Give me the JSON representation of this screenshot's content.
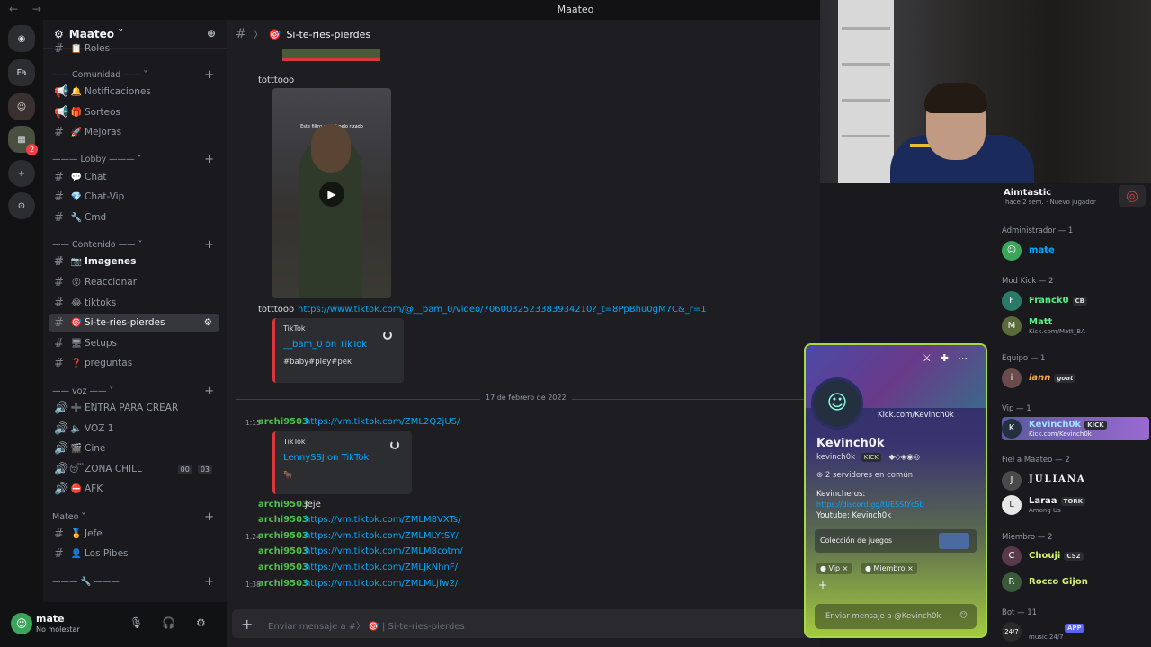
{
  "window": {
    "title": "Maateo",
    "nav": "← →"
  },
  "server": {
    "name": "Maateo ˅",
    "list": [
      "Fa"
    ]
  },
  "categories": {
    "comunidad": "—— Comunidad ——",
    "lobby": "——— Lobby ———",
    "contenido": "—— Contenido ——",
    "voz": "—— voz ——",
    "maateo": "Mateo"
  },
  "channels": {
    "roles": "Roles",
    "notificaciones": "Notificaciones",
    "sorteos": "Sorteos",
    "mejoras": "Mejoras",
    "chat": "Chat",
    "chatvip": "Chat-Vip",
    "cmd": "Cmd",
    "imagenes": "Imagenes",
    "reaccionar": "Reaccionar",
    "tiktoks": "tiktoks",
    "sirie": "Si-te-ries-pierdes",
    "setups": "Setups",
    "preguntas": "preguntas",
    "entra": "ENTRA PARA CREAR",
    "voz1": "VOZ 1",
    "cine": "Cine",
    "zona": "ZONA CHILL",
    "zona_counts": [
      "00",
      "03"
    ],
    "afk": "AFK",
    "jefe": "Jefe",
    "pibes": "Los Pibes"
  },
  "user": {
    "name": "mate",
    "status": "No molestar"
  },
  "chat": {
    "header": "Si-te-ries-pierdes",
    "msg1_text": "totttooo",
    "video_caption": "Este filtro con el pelo rizado",
    "msg2_text": "totttooo",
    "msg2_link": "https://www.tiktok.com/@__bam_0/video/7060032523383934210?_t=8PpBhu0gM7C&_r=1",
    "embed1": {
      "provider": "TikTok",
      "title": "__bam_0 on TikTok",
      "desc": "#baby#pley#pек"
    },
    "date_divider": "17 de febrero de 2022",
    "msg3": {
      "time": "1:15",
      "author": "archi9503",
      "link": "https://vm.tiktok.com/ZML2Q2jUS/"
    },
    "embed2": {
      "provider": "TikTok",
      "title": "LennySSJ on TikTok"
    },
    "msg4": {
      "author": "archi9503",
      "text": "jeje"
    },
    "msg5": {
      "author": "archi9503",
      "link": "https://vm.tiktok.com/ZMLM8VXTs/"
    },
    "msg6": {
      "time": "1:24",
      "author": "archi9503",
      "link": "https://vm.tiktok.com/ZMLMLYtSY/"
    },
    "msg7": {
      "author": "archi9503",
      "link": "https://vm.tiktok.com/ZMLM8cotm/"
    },
    "msg8": {
      "author": "archi9503",
      "link": "https://vm.tiktok.com/ZMLJkNhnF/"
    },
    "msg9": {
      "time": "1:38",
      "author": "archi9503",
      "link": "https://vm.tiktok.com/ZMLMLjfw2/"
    },
    "input_placeholder": "Enviar mensaje a #〉 🎯 | Si-te-ries-pierdes"
  },
  "members": {
    "top": {
      "name": "Aimtastic",
      "sub": "hace 2 sem. · Nuevo jugador"
    },
    "admin_cat": "Administrador — 1",
    "admin": {
      "name": "mate"
    },
    "modkick_cat": "Mod Kick — 2",
    "franck": {
      "name": "Franck0",
      "tag": "CB"
    },
    "matt": {
      "name": "Matt",
      "sub": "Kick.com/Matt_BA"
    },
    "equipo_cat": "Equipo — 1",
    "iann": {
      "name": "iann",
      "tag": "goat"
    },
    "vip_cat": "Vip — 1",
    "kevinch": {
      "name": "Kevinch0k",
      "tag": "KICK",
      "sub": "Kick.com/Kevinch0k"
    },
    "fiel_cat": "Fiel a Maateo — 2",
    "juliana": {
      "name": "JULIANA"
    },
    "laraa": {
      "name": "Laraa",
      "tag": "TORK",
      "sub": "Among Us"
    },
    "miembro_cat": "Miembro — 2",
    "chouji": {
      "name": "Chouji",
      "tag": "CS2"
    },
    "rocco": {
      "name": "Rocco Gijon"
    },
    "bot_cat": "Bot — 11",
    "bot": {
      "tag": "APP",
      "sub": "music 24/7"
    }
  },
  "profile": {
    "kick_link": "Kick.com/Kevinch0k",
    "name": "Kevinch0k",
    "username": "kevinch0k",
    "badge": "KICK",
    "mutual": "2 servidores en común",
    "bio_title": "Kevincheros:",
    "bio_link": "https://discord.gg/tUESSfYc5b",
    "bio_youtube": "Youtube: Kevinch0k",
    "games_label": "Colección de juegos",
    "roles": [
      "Vip",
      "Miembro"
    ],
    "message_placeholder": "Enviar mensaje a @Kevinch0k"
  },
  "colors": {
    "accent": "#00a8fc",
    "author": "#4fbf4f",
    "profile_border": "#a7d946"
  }
}
